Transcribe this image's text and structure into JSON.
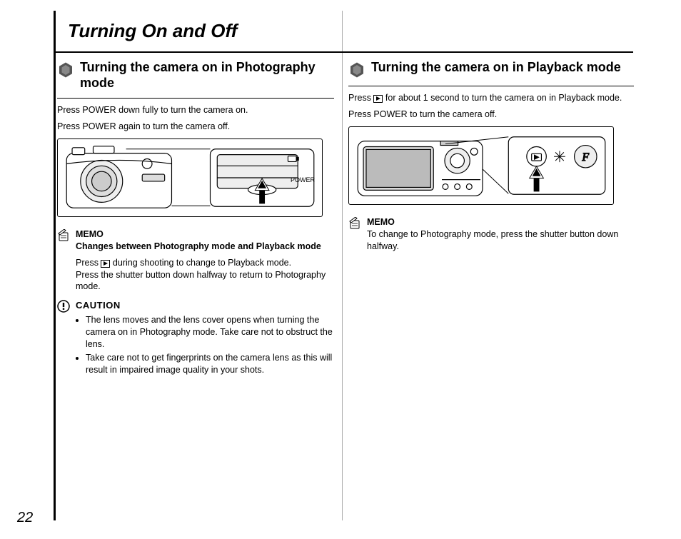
{
  "page": {
    "title": "Turning On and Off",
    "number": "22"
  },
  "left": {
    "heading": "Turning the camera on in Photography mode",
    "body1": "Press POWER down fully to turn the camera on.",
    "body2": "Press POWER again to turn the camera off.",
    "illus_label": "POWER",
    "memo": {
      "label": "MEMO",
      "subtitle": "Changes between Photography mode and Playback mode",
      "text1_a": "Press ",
      "text1_b": " during shooting to change to Playback mode.",
      "text2": "Press the shutter button down halfway to return to Photography mode."
    },
    "caution": {
      "label": "CAUTION",
      "bullets": [
        "The lens moves and the lens cover opens when turning the camera on in Photography mode. Take care not to obstruct the lens.",
        "Take care not to get fingerprints on the camera lens as this will result in impaired image quality in your shots."
      ]
    }
  },
  "right": {
    "heading": "Turning the camera on in Playback mode",
    "body1_a": "Press ",
    "body1_b": " for about 1 second to turn the camera on in Playback mode.",
    "body2": "Press POWER to turn the camera off.",
    "memo": {
      "label": "MEMO",
      "text": "To change to Photography mode, press the shutter button down halfway."
    }
  }
}
